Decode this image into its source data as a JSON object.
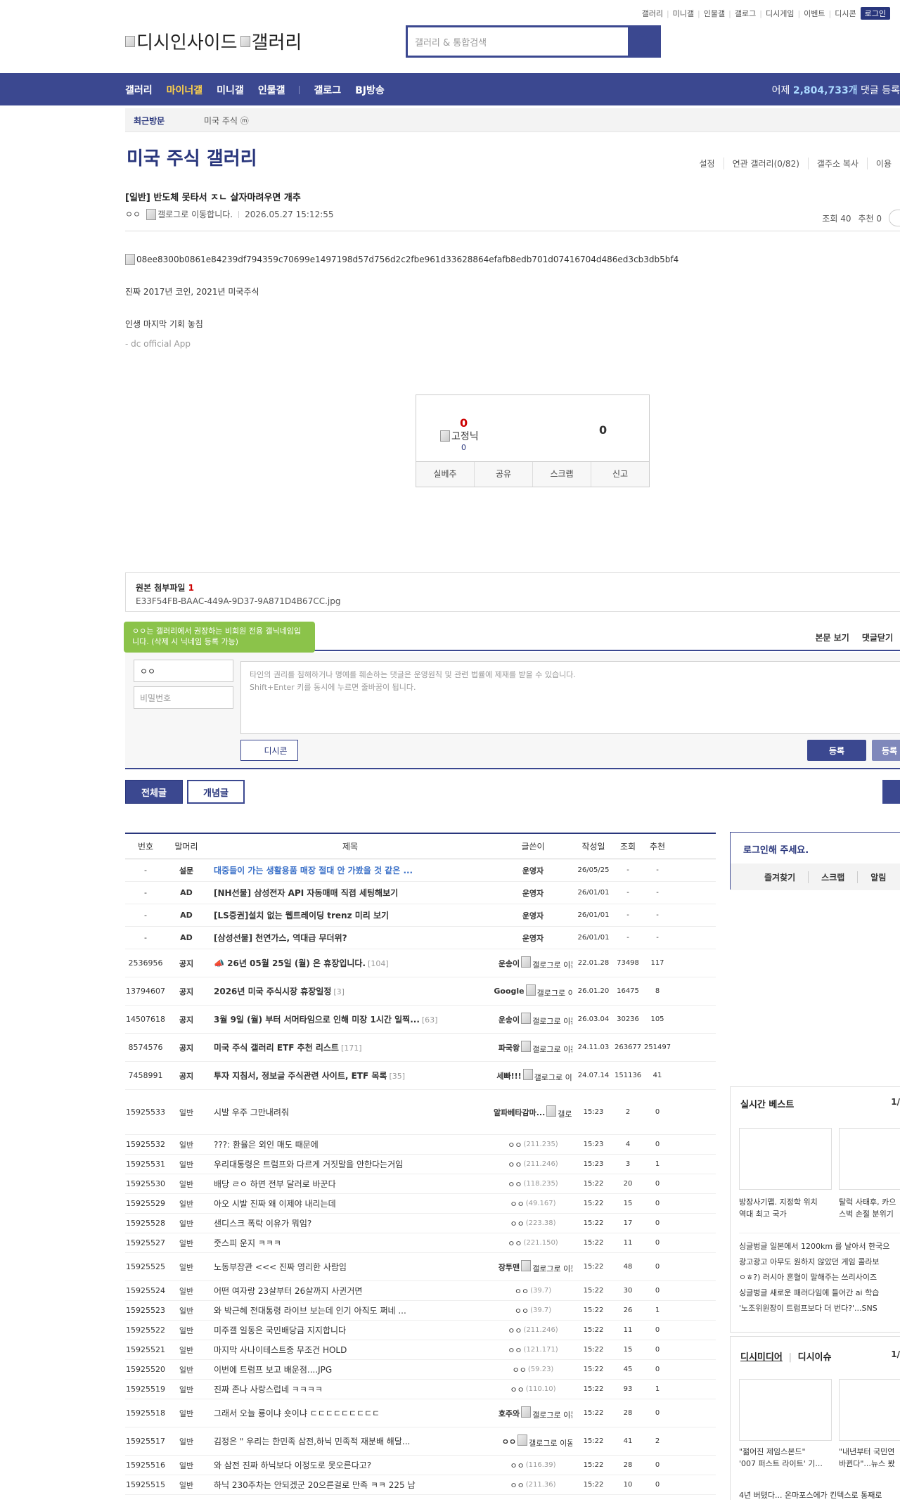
{
  "top_links": [
    "갤러리",
    "미니갤",
    "인물갤",
    "갤로그",
    "디시게임",
    "이벤트",
    "디시콘"
  ],
  "login_label": "로그인",
  "logo": {
    "main": "디시인사이드",
    "sub": "갤러리"
  },
  "search": {
    "placeholder": "갤러리 & 통합검색"
  },
  "gnb": {
    "items": [
      "갤러리",
      "마이너갤",
      "미니갤",
      "인물갤",
      "갤로그",
      "BJ방송"
    ],
    "count_prefix": "어제 ",
    "count_value": "2,804,733개",
    "count_suffix": " 댓글 등록"
  },
  "visit": {
    "label": "최근방문",
    "item": "미국 주식 ⓜ"
  },
  "gallery_title": "미국 주식 갤러리",
  "gallery_menu": [
    "설정",
    "연관 갤러리(0/82)",
    "갤주소 복사",
    "이용"
  ],
  "post": {
    "title": "[일반] 반도체 못타서 ㅈㄴ 살자마려우면 개추",
    "author": "ㅇㅇ",
    "author_img_alt": "갤로그로 이동합니다.",
    "date": "2026.05.27 15:12:55",
    "views": "조회 40",
    "recommend": "추천 0",
    "image_alt": "08ee8300b0861e84239df794359c70699e1497198d57d756d2c2fbe961d33628864efafb8edb701d07416704d486ed3cb3db5bf4",
    "lines": [
      "진짜 2017년 코인, 2021년 미국주식",
      "인생 마지막 기회 놓침"
    ],
    "app_sig": "- dc official App"
  },
  "vote": {
    "up": "0",
    "fixed_alt": "고정닉",
    "fixed_count": "0",
    "down": "0",
    "buttons": [
      "실베추",
      "공유",
      "스크랩",
      "신고"
    ]
  },
  "attach": {
    "label": "원본 첨부파일 ",
    "count": "1",
    "file": "E33F54FB-BAAC-449A-9D37-9A871D4B67CC.jpg"
  },
  "tooltip": "ㅇㅇ는 갤러리에서 권장하는 비회원 전용 갤닉네임입니다. (삭제 시 닉네임 등록 가능)",
  "comment": {
    "tabs": [
      "본문 보기",
      "댓글닫기"
    ],
    "name_value": "ㅇㅇ",
    "pw_placeholder": "비밀번호",
    "text_placeholder": "타인의 권리를 침해하거나 명예를 훼손하는 댓글은 운영원칙 및 관련 법률에 제재를 받을 수 있습니다.",
    "text_placeholder2": "Shift+Enter 키를 동시에 누르면 줄바꿈이 됩니다.",
    "dccon": "디시콘",
    "submit": "등록",
    "submit2": "등록"
  },
  "list_tabs": [
    "전체글",
    "개념글"
  ],
  "list_head": [
    "번호",
    "말머리",
    "제목",
    "글쓴이",
    "작성일",
    "조회",
    "추천"
  ],
  "rows": [
    {
      "no": "-",
      "head": "설문",
      "title": "대중들이 가는 생활용품 매장 절대 안 가봤을 것 같은 ...",
      "cmt": "",
      "writer": "운영자",
      "ip": "",
      "gl": "",
      "date": "26/05/25",
      "views": "-",
      "rec": "-",
      "bold": true,
      "blue": true
    },
    {
      "no": "-",
      "head": "AD",
      "title": "[NH선물] 삼성전자 API 자동매매 직접 세팅해보기",
      "cmt": "",
      "writer": "운영자",
      "ip": "",
      "gl": "",
      "date": "26/01/01",
      "views": "-",
      "rec": "-",
      "bold": true
    },
    {
      "no": "-",
      "head": "AD",
      "title": "[LS증권]설치 없는 웹트레이딩 trenz 미리 보기",
      "cmt": "",
      "writer": "운영자",
      "ip": "",
      "gl": "",
      "date": "26/01/01",
      "views": "-",
      "rec": "-",
      "bold": true
    },
    {
      "no": "-",
      "head": "AD",
      "title": "[삼성선물] 천연가스, 역대급 무더위?",
      "cmt": "",
      "writer": "운영자",
      "ip": "",
      "gl": "",
      "date": "26/01/01",
      "views": "-",
      "rec": "-",
      "bold": true
    },
    {
      "no": "2536956",
      "head": "공지",
      "title": "📣 26년 05월 25일 (월) 은 휴장입니다.",
      "cmt": "[104]",
      "writer": "운송이",
      "ip": "",
      "gl": "갤로그로 이동합니다.",
      "date": "22.01.28",
      "views": "73498",
      "rec": "117",
      "bold": true
    },
    {
      "no": "13794607",
      "head": "공지",
      "title": "2026년 미국 주식시장 휴장일정",
      "cmt": "[3]",
      "writer": "Google",
      "ip": "",
      "gl": "갤로그로 이동합니다.",
      "date": "26.01.20",
      "views": "16475",
      "rec": "8",
      "bold": true
    },
    {
      "no": "14507618",
      "head": "공지",
      "title": "3월 9일 (월) 부터 서머타임으로 인해 미장 1시간 일찍...",
      "cmt": "[63]",
      "writer": "운송이",
      "ip": "",
      "gl": "갤로그로 이동합니다.",
      "date": "26.03.04",
      "views": "30236",
      "rec": "105",
      "bold": true
    },
    {
      "no": "8574576",
      "head": "공지",
      "title": "미국 주식 갤러리 ETF 추천 리스트",
      "cmt": "[171]",
      "writer": "파국왕",
      "ip": "",
      "gl": "갤로그로 이동합니다.",
      "date": "24.11.03",
      "views": "263677",
      "rec": "251497",
      "bold": true
    },
    {
      "no": "7458991",
      "head": "공지",
      "title": "투자 지침서, 정보글 주식관련 사이트, ETF 목록",
      "cmt": "[35]",
      "writer": "세빠!!!",
      "ip": "",
      "gl": "갤로그로 이동합니다.",
      "date": "24.07.14",
      "views": "151136",
      "rec": "41",
      "bold": true
    },
    {
      "no": "15925533",
      "head": "일반",
      "title": "시발 우주 그만내려줘",
      "cmt": "",
      "writer": "알파베타감마...",
      "ip": "",
      "gl": "갤로그로 이동합니다.",
      "date": "15:23",
      "views": "2",
      "rec": "0",
      "tall": true
    },
    {
      "no": "15925532",
      "head": "일반",
      "title": "???: 환율은 외인 매도 때문에",
      "cmt": "",
      "writer": "ㅇㅇ",
      "ip": "(211.235)",
      "gl": "",
      "date": "15:23",
      "views": "4",
      "rec": "0"
    },
    {
      "no": "15925531",
      "head": "일반",
      "title": "우리대통령은 트럼프와 다르게 거짓말을 안한다는거임",
      "cmt": "",
      "writer": "ㅇㅇ",
      "ip": "(211.246)",
      "gl": "",
      "date": "15:23",
      "views": "3",
      "rec": "1"
    },
    {
      "no": "15925530",
      "head": "일반",
      "title": "배당 ㄹㅇ 하면 전부 달러로 바꾼다",
      "cmt": "",
      "writer": "ㅇㅇ",
      "ip": "(118.235)",
      "gl": "",
      "date": "15:22",
      "views": "20",
      "rec": "0"
    },
    {
      "no": "15925529",
      "head": "일반",
      "title": "아오 시발 진짜 왜 이제야 내리는데",
      "cmt": "",
      "writer": "ㅇㅇ",
      "ip": "(49.167)",
      "gl": "",
      "date": "15:22",
      "views": "15",
      "rec": "0"
    },
    {
      "no": "15925528",
      "head": "일반",
      "title": "샌디스크 폭락 이유가 뭐임?",
      "cmt": "",
      "writer": "ㅇㅇ",
      "ip": "(223.38)",
      "gl": "",
      "date": "15:22",
      "views": "17",
      "rec": "0"
    },
    {
      "no": "15925527",
      "head": "일반",
      "title": "줏스피 운지 ㅋㅋㅋ",
      "cmt": "",
      "writer": "ㅇㅇ",
      "ip": "(221.150)",
      "gl": "",
      "date": "15:22",
      "views": "11",
      "rec": "0"
    },
    {
      "no": "15925525",
      "head": "일반",
      "title": "노동부장관 <<< 진짜 영리한 사람임",
      "cmt": "",
      "writer": "장투맨",
      "ip": "",
      "gl": "갤로그로 이동합니다.",
      "date": "15:22",
      "views": "48",
      "rec": "0"
    },
    {
      "no": "15925524",
      "head": "일반",
      "title": "어떤 여자랑 23살부터 26살까지 사귄거면",
      "cmt": "",
      "writer": "ㅇㅇ",
      "ip": "(39.7)",
      "gl": "",
      "date": "15:22",
      "views": "30",
      "rec": "0"
    },
    {
      "no": "15925523",
      "head": "일반",
      "title": "와 박근혜 전대통령 라이브 보는데 인기 아직도 쩌네 ...",
      "cmt": "",
      "writer": "ㅇㅇ",
      "ip": "(39.7)",
      "gl": "",
      "date": "15:22",
      "views": "26",
      "rec": "1"
    },
    {
      "no": "15925522",
      "head": "일반",
      "title": "미주갤 일동은 국민배당금 지지합니다",
      "cmt": "",
      "writer": "ㅇㅇ",
      "ip": "(211.246)",
      "gl": "",
      "date": "15:22",
      "views": "11",
      "rec": "0"
    },
    {
      "no": "15925521",
      "head": "일반",
      "title": "마지막 사나이테스트중 무조건 HOLD",
      "cmt": "",
      "writer": "ㅇㅇ",
      "ip": "(121.171)",
      "gl": "",
      "date": "15:22",
      "views": "15",
      "rec": "0"
    },
    {
      "no": "15925520",
      "head": "일반",
      "title": "이번에 트럼프 보고 배운점....JPG",
      "cmt": "",
      "writer": "ㅇㅇ",
      "ip": "(59.23)",
      "gl": "",
      "date": "15:22",
      "views": "45",
      "rec": "0"
    },
    {
      "no": "15925519",
      "head": "일반",
      "title": "진짜 존나 사랑스럽네 ㅋㅋㅋㅋ",
      "cmt": "",
      "writer": "ㅇㅇ",
      "ip": "(110.10)",
      "gl": "",
      "date": "15:22",
      "views": "93",
      "rec": "1"
    },
    {
      "no": "15925518",
      "head": "일반",
      "title": "그래서 오늘 룡이냐 숏이냐 ㄷㄷㄷㄷㄷㄷㄷㄷㄷ",
      "cmt": "",
      "writer": "호주와",
      "ip": "",
      "gl": "갤로그로 이동합니다.",
      "date": "15:22",
      "views": "28",
      "rec": "0"
    },
    {
      "no": "15925517",
      "head": "일반",
      "title": "김정은 \" 우리는 한민족 삼전,하닉 민족적 재분배 해달...",
      "cmt": "",
      "writer": "ㅇㅇ",
      "ip": "",
      "gl": "갤로그로 이동합니다.",
      "date": "15:22",
      "views": "41",
      "rec": "2"
    },
    {
      "no": "15925516",
      "head": "일반",
      "title": "와 삼전 진짜 하닉보다 이정도로 못오른다고?",
      "cmt": "",
      "writer": "ㅇㅇ",
      "ip": "(116.39)",
      "gl": "",
      "date": "15:22",
      "views": "28",
      "rec": "0"
    },
    {
      "no": "15925515",
      "head": "일반",
      "title": "하닉 230주차는 안되겠군 20으른걸로 만족 ㅋㅋ 225 남",
      "cmt": "",
      "writer": "ㅇㅇ",
      "ip": "(211.36)",
      "gl": "",
      "date": "15:22",
      "views": "10",
      "rec": "0"
    }
  ],
  "sidebar": {
    "login_title": "로그인해 주세요.",
    "login_links": [
      "즐겨찾기",
      "스크랩",
      "알림"
    ],
    "best_title": "실시간 베스트",
    "best_page": "1/",
    "best_caps": [
      [
        "방장사기맵. 지정학 위치",
        "역대 최고 국가"
      ],
      [
        "탈럭 사태후, 카으",
        "스벅 손절 분위기"
      ]
    ],
    "best_list": [
      "싱글벙글 일본에서 1200km 를 날아서 한국으",
      "광고광고 아무도 원하지 않았던 게임 콜라보",
      "ㅇㅎ?) 러시아 혼혈이 말해주는 쓰리사이즈",
      "싱글벙글 새로운 패러다임에 들어간 ai 학습",
      "'노조위원장이 트럼프보다 더 번다?'...SNS"
    ],
    "media_title": "디시미디어",
    "media_title2": "디시이슈",
    "media_page": "1/",
    "media_caps": [
      [
        "\"젊어진 제임스본드\"",
        "'007 퍼스트 라이트' 기..."
      ],
      [
        "\"내년부터 국민연",
        "바뀐다\"...뉴스 봤"
      ]
    ],
    "media_last": "4년 버텼다... 온마포스에가 킨텍스로 통째로"
  }
}
